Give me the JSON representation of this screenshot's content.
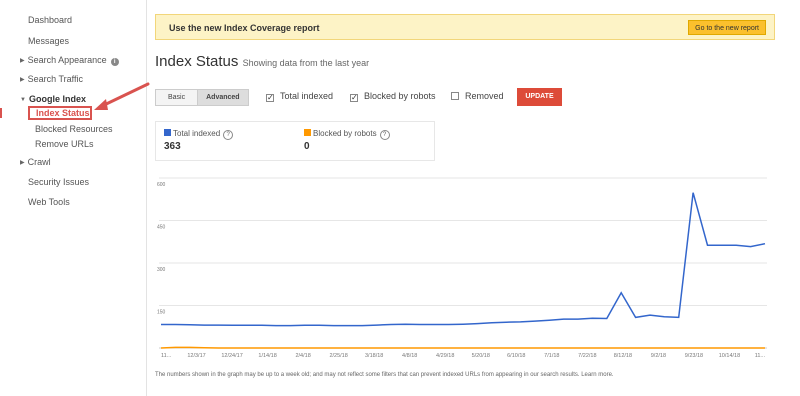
{
  "sidebar": {
    "items": [
      {
        "label": "Dashboard"
      },
      {
        "label": "Messages"
      },
      {
        "label": "Search Appearance"
      },
      {
        "label": "Search Traffic"
      },
      {
        "label": "Google Index"
      },
      {
        "label": "Index Status"
      },
      {
        "label": "Blocked Resources"
      },
      {
        "label": "Remove URLs"
      },
      {
        "label": "Crawl"
      },
      {
        "label": "Security Issues"
      },
      {
        "label": "Web Tools"
      }
    ],
    "info_glyph": "i"
  },
  "banner": {
    "text": "Use the new Index Coverage report",
    "button": "Go to the new report"
  },
  "header": {
    "title": "Index Status",
    "subtitle": "Showing data from the last year"
  },
  "controls": {
    "basic": "Basic",
    "advanced": "Advanced",
    "checks": [
      {
        "label": "Total indexed",
        "checked": true
      },
      {
        "label": "Blocked by robots",
        "checked": true
      },
      {
        "label": "Removed",
        "checked": false
      }
    ],
    "update": "UPDATE"
  },
  "stats": [
    {
      "label": "Total indexed",
      "value": "363",
      "color": "#3366cc"
    },
    {
      "label": "Blocked by robots",
      "value": "0",
      "color": "#ff9900"
    }
  ],
  "chart_data": {
    "type": "line",
    "ylim": [
      0,
      600
    ],
    "yticks": [
      "600",
      "450",
      "300",
      "150"
    ],
    "xticks": [
      "11...",
      "12/3/17",
      "12/24/17",
      "1/14/18",
      "2/4/18",
      "2/25/18",
      "3/18/18",
      "4/8/18",
      "4/29/18",
      "5/20/18",
      "6/10/18",
      "7/1/18",
      "7/22/18",
      "8/12/18",
      "9/2/18",
      "9/23/18",
      "10/14/18",
      "11..."
    ],
    "series": [
      {
        "name": "Total indexed",
        "color": "#3366cc",
        "values": [
          83,
          83,
          82,
          81,
          81,
          80,
          80,
          80,
          79,
          79,
          80,
          80,
          79,
          79,
          79,
          81,
          83,
          84,
          83,
          83,
          83,
          84,
          86,
          89,
          91,
          92,
          95,
          98,
          102,
          102,
          105,
          104,
          195,
          108,
          116,
          110,
          108,
          548,
          363,
          363,
          363,
          358,
          368
        ]
      },
      {
        "name": "Blocked by robots",
        "color": "#ff9900",
        "values": [
          0,
          2,
          2,
          1,
          0,
          0,
          0,
          0,
          0,
          0,
          0,
          0,
          0,
          0,
          0,
          0,
          0,
          0,
          0,
          0,
          0,
          0,
          0,
          0,
          0,
          0,
          0,
          0,
          0,
          0,
          0,
          0,
          0,
          0,
          0,
          0,
          0,
          0,
          0,
          0,
          0,
          0,
          0
        ]
      }
    ]
  },
  "footnote": "The numbers shown in the graph may be up to a week old; and may not reflect some filters that can prevent indexed URLs from appearing in our search results. Learn more."
}
